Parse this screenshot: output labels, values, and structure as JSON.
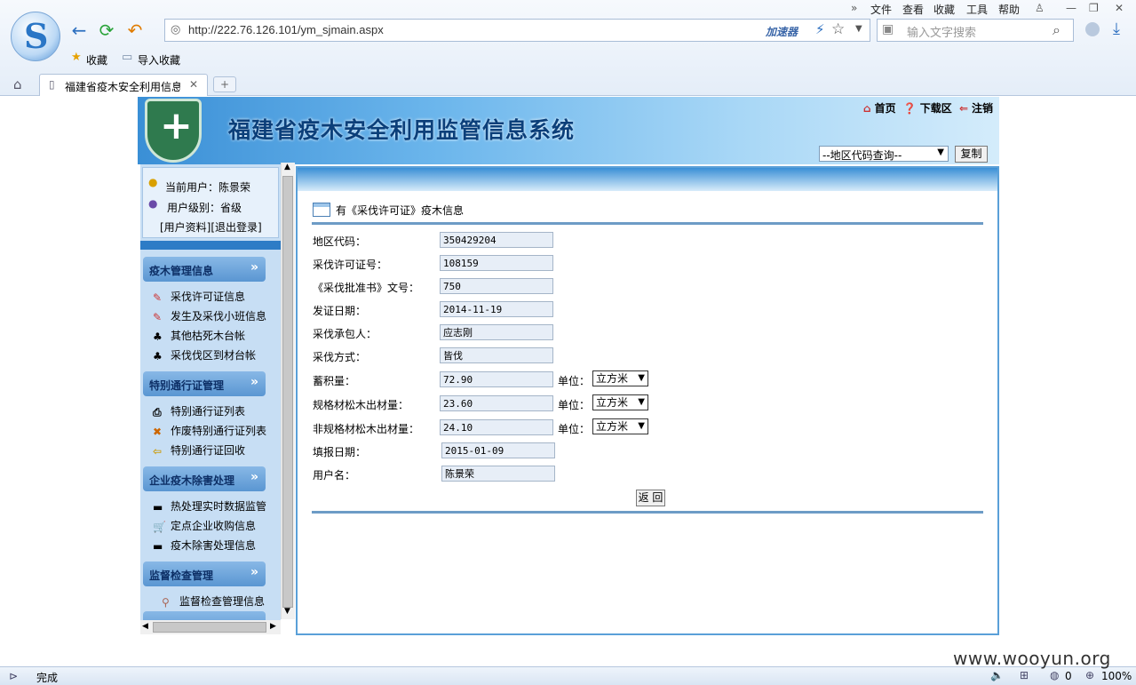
{
  "browser": {
    "menu": [
      "文件",
      "查看",
      "收藏",
      "工具",
      "帮助"
    ],
    "url": "http://222.76.126.101/ym_sjmain.aspx",
    "accelerator": "加速器",
    "search_placeholder": "输入文字搜索",
    "bookmarks": [
      "收藏",
      "导入收藏"
    ],
    "tab_title": "福建省疫木安全利用信息",
    "status_text": "完成",
    "status_zoom": "100%",
    "status_count": "0"
  },
  "watermark": "www.wooyun.org",
  "site": {
    "title": "福建省疫木安全利用监管信息系统",
    "links": {
      "home": "首页",
      "download": "下载区",
      "logout": "注销"
    },
    "region_select": "--地区代码查询--",
    "copy_button": "复制"
  },
  "sidebar": {
    "current_user": "当前用户：陈景荣",
    "user_level": "用户级别：省级",
    "user_links": "[用户资料][退出登录]",
    "sections": [
      {
        "title": "疫木管理信息",
        "items": [
          "采伐许可证信息",
          "发生及采伐小班信息",
          "其他枯死木台帐",
          "采伐伐区到材台帐"
        ]
      },
      {
        "title": "特别通行证管理",
        "items": [
          "特别通行证列表",
          "作废特别通行证列表",
          "特别通行证回收"
        ]
      },
      {
        "title": "企业疫木除害处理",
        "items": [
          "热处理实时数据监管",
          "定点企业收购信息",
          "疫木除害处理信息"
        ]
      },
      {
        "title": "监督检查管理",
        "items": [
          "监督检查管理信息"
        ]
      }
    ]
  },
  "form": {
    "title": "有《采伐许可证》疫木信息",
    "fields": [
      {
        "label": "地区代码：",
        "value": "350429204"
      },
      {
        "label": "采伐许可证号：",
        "value": "108159"
      },
      {
        "label": "《采伐批准书》文号：",
        "value": "750"
      },
      {
        "label": "发证日期：",
        "value": "2014-11-19"
      },
      {
        "label": "采伐承包人：",
        "value": "应志刚"
      },
      {
        "label": "采伐方式：",
        "value": "皆伐"
      },
      {
        "label": "蓄积量：",
        "value": "72.90"
      },
      {
        "label": "规格材松木出材量：",
        "value": "23.60"
      },
      {
        "label": "非规格材松木出材量：",
        "value": "24.10"
      },
      {
        "label": "填报日期：",
        "value": "2015-01-09"
      },
      {
        "label": "用户名：",
        "value": "陈景荣"
      }
    ],
    "unit_label": "单位：",
    "unit_value": "立方米",
    "back_button": "返 回"
  }
}
